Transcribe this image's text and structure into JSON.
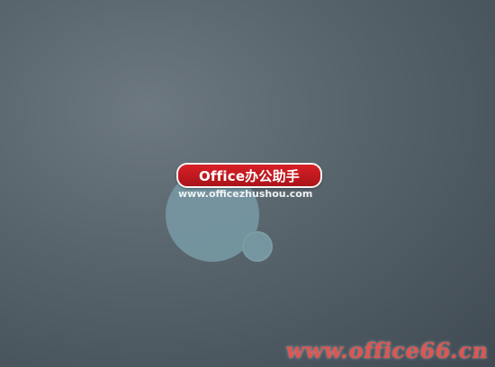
{
  "logo": {
    "title": "Office办公助手",
    "url": "www.officezhushou.com"
  },
  "watermark": {
    "text": "www.office66.cn"
  },
  "colors": {
    "background_center": "#6d7880",
    "background_edge": "#3f4a53",
    "circle": "#7596a0",
    "logo_red": "#c81b22",
    "watermark_red": "#e94c47"
  }
}
